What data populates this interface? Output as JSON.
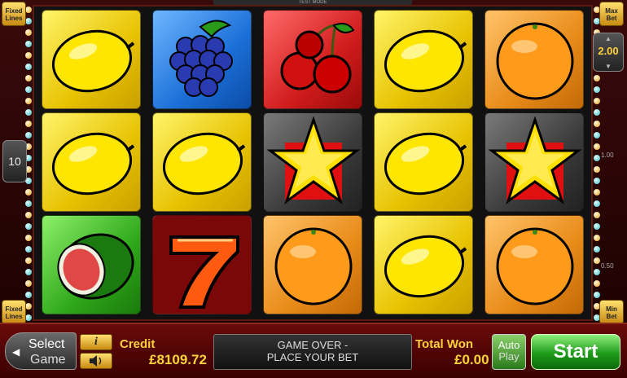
{
  "top_label": "TEST MODE",
  "left_panel": {
    "fixed_lines_top": "Fixed Lines",
    "lines_value": "10",
    "fixed_lines_bottom": "Fixed Lines"
  },
  "right_panel": {
    "max_bet": "Max Bet",
    "bet_value": "2.00",
    "scale_top": "1.00",
    "scale_bottom": "0.50",
    "min_bet": "Min Bet"
  },
  "reels": [
    [
      "lemon",
      "lemon",
      "watermelon"
    ],
    [
      "grapes",
      "lemon",
      "seven"
    ],
    [
      "cherries",
      "star",
      "orange"
    ],
    [
      "lemon",
      "lemon",
      "lemon"
    ],
    [
      "orange",
      "star",
      "orange"
    ]
  ],
  "bottom_bar": {
    "select_game_line1": "Select",
    "select_game_line2": "Game",
    "info_label": "i",
    "credit_label": "Credit",
    "credit_value": "£8109.72",
    "message_line1": "GAME OVER -",
    "message_line2": "PLACE YOUR BET",
    "total_won_label": "Total Won",
    "total_won_value": "£0.00",
    "auto_play_line1": "Auto",
    "auto_play_line2": "Play",
    "start_label": "Start"
  },
  "colors": {
    "frame": "#3a0a0a",
    "gold_text": "#ffd23a",
    "start_green": "#1e9a1a"
  }
}
